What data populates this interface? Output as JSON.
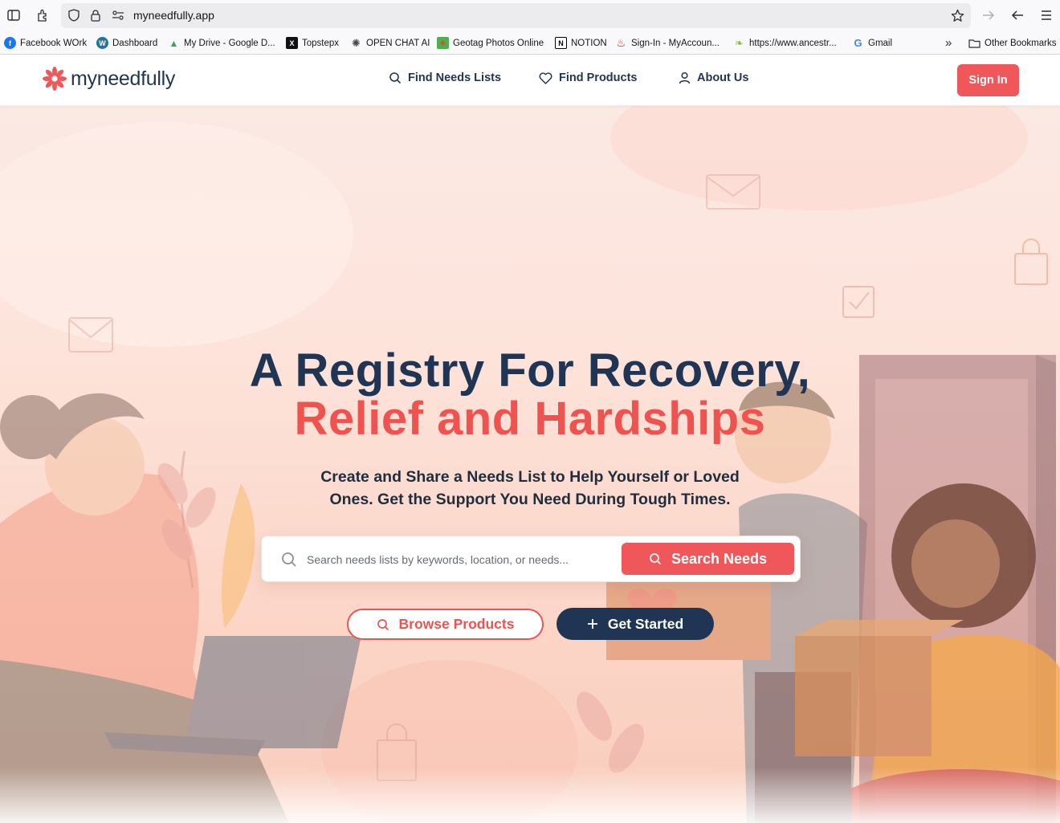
{
  "browser": {
    "url": "myneedfully.app",
    "bookmarks": [
      {
        "label": "Facebook WOrk",
        "icon": "facebook-icon",
        "color": "#1877f2",
        "glyph": "f"
      },
      {
        "label": "Dashboard",
        "icon": "wordpress-icon",
        "color": "#21759b",
        "glyph": "W"
      },
      {
        "label": "My Drive - Google D...",
        "icon": "google-drive-icon",
        "color": "#34a853",
        "glyph": "▲"
      },
      {
        "label": "Topstepx",
        "icon": "topstepx-icon",
        "color": "#111111",
        "glyph": "X"
      },
      {
        "label": "OPEN CHAT AI",
        "icon": "openai-icon",
        "color": "#444444",
        "glyph": "✺"
      },
      {
        "label": "Geotag Photos Online",
        "icon": "map-icon",
        "color": "#e44d26",
        "glyph": "◆"
      },
      {
        "label": "NOTION",
        "icon": "notion-icon",
        "color": "#000000",
        "glyph": "N"
      },
      {
        "label": "Sign-In - MyAccoun...",
        "icon": "santander-icon",
        "color": "#ec0000",
        "glyph": "♨"
      },
      {
        "label": "https://www.ancestr...",
        "icon": "ancestry-icon",
        "color": "#8bbb3a",
        "glyph": "❧"
      },
      {
        "label": "Gmail",
        "icon": "google-icon",
        "color": "#4285f4",
        "glyph": "G"
      }
    ],
    "other_bookmarks": "Other Bookmarks"
  },
  "site": {
    "logo_text": "myneedfully",
    "brand_color": "#f0575a",
    "navy_color": "#1f3553",
    "nav": {
      "find_needs": "Find Needs Lists",
      "find_products": "Find Products",
      "about": "About Us"
    },
    "sign_in": "Sign In"
  },
  "hero": {
    "title_line1": "A Registry For Recovery,",
    "title_line2": "Relief and Hardships",
    "subtitle": "Create and Share a Needs List to Help Yourself or Loved Ones. Get the Support You Need During Tough Times.",
    "search_placeholder": "Search needs lists by keywords, location, or needs...",
    "search_button": "Search Needs",
    "browse_button": "Browse Products",
    "start_button": "Get Started"
  }
}
